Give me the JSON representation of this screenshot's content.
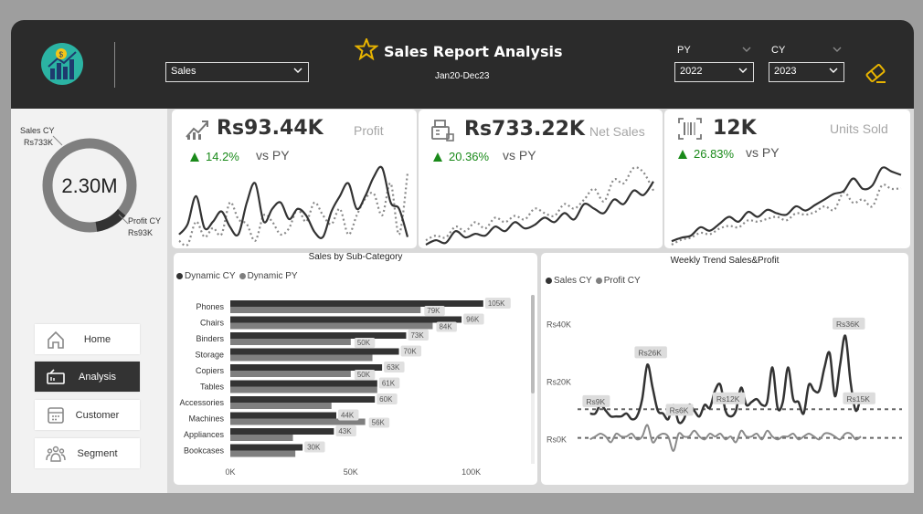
{
  "header": {
    "title": "Sales Report Analysis",
    "subtitle": "Jan20-Dec23",
    "measure_selector": {
      "value": "Sales"
    },
    "py_label": "PY",
    "py_value": "2022",
    "cy_label": "CY",
    "cy_value": "2023"
  },
  "sidebar": {
    "donut": {
      "center_text": "2.30M",
      "sales_label": "Sales CY",
      "sales_value": "Rs733K",
      "profit_label": "Profit CY",
      "profit_value": "Rs93K",
      "sales_share": 0.887,
      "profit_share": 0.113
    },
    "nav": [
      {
        "label": "Home",
        "icon": "home-icon"
      },
      {
        "label": "Analysis",
        "icon": "analysis-icon",
        "active": true
      },
      {
        "label": "Customer",
        "icon": "customer-icon"
      },
      {
        "label": "Segment",
        "icon": "segment-icon"
      }
    ]
  },
  "kpis": [
    {
      "value": "Rs93.44K",
      "label": "Profit",
      "delta": "14.2%",
      "vs": "vs PY",
      "icon": "trend-up-icon"
    },
    {
      "value": "Rs733.22K",
      "label": "Net Sales",
      "delta": "20.36%",
      "vs": "vs PY",
      "icon": "cash-register-icon"
    },
    {
      "value": "12K",
      "label": "Units Sold",
      "delta": "26.83%",
      "vs": "vs PY",
      "icon": "barcode-icon"
    }
  ],
  "colors": {
    "header": "#2b2b2b",
    "dark_series": "#333333",
    "light_series": "#7f7f7f",
    "positive": "#1a8a1a",
    "accent": "#e8b400",
    "logo_bg": "#2bb3a3"
  },
  "chart_data": [
    {
      "type": "bar",
      "title": "Sales by Sub-Category",
      "categories": [
        "Phones",
        "Chairs",
        "Binders",
        "Storage",
        "Copiers",
        "Tables",
        "Accessories",
        "Machines",
        "Appliances",
        "Bookcases"
      ],
      "series": [
        {
          "name": "Dynamic CY",
          "values": [
            105,
            96,
            73,
            70,
            63,
            61,
            60,
            44,
            43,
            30
          ]
        },
        {
          "name": "Dynamic PY",
          "values": [
            79,
            84,
            50,
            59,
            50,
            61,
            42,
            56,
            26,
            27
          ]
        }
      ],
      "data_labels": [
        "105K",
        "96K",
        "73K",
        "70K",
        "63K",
        "61K",
        "60K",
        "44K",
        "43K",
        "30K"
      ],
      "pyonly_labels": [
        "79K",
        "84K",
        "50K",
        null,
        "50K",
        null,
        null,
        "56K",
        null,
        null
      ],
      "xticks": [
        "0K",
        "50K",
        "100K"
      ],
      "xlim": [
        0,
        110
      ],
      "legend": "top-left"
    },
    {
      "type": "line",
      "title": "Weekly Trend Sales&Profit",
      "x": [
        1,
        2,
        3,
        4,
        5,
        6,
        7,
        8,
        9,
        10,
        11,
        12,
        13,
        14,
        15,
        16,
        17,
        18,
        19,
        20,
        21,
        22,
        23,
        24,
        25,
        26,
        27,
        28,
        29,
        30,
        31,
        32,
        33,
        34,
        35,
        36,
        37,
        38,
        39,
        40,
        41,
        42,
        43,
        44,
        45,
        46,
        47,
        48,
        49,
        50,
        51,
        52,
        53
      ],
      "series": [
        {
          "name": "Sales CY",
          "values": [
            9,
            9,
            12,
            10,
            8,
            8,
            8,
            9,
            7,
            8,
            14,
            26,
            18,
            10,
            9,
            7,
            12,
            6,
            7,
            12,
            10,
            8,
            12,
            11,
            17,
            19,
            10,
            8,
            10,
            18,
            12,
            13,
            14,
            12,
            13,
            25,
            11,
            13,
            25,
            14,
            13,
            9,
            19,
            17,
            17,
            25,
            30,
            15,
            26,
            36,
            20,
            10,
            15
          ]
        },
        {
          "name": "Profit CY",
          "values": [
            0,
            1,
            2,
            1,
            -1,
            2,
            1,
            1,
            2,
            0,
            1,
            5,
            -1,
            1,
            2,
            1,
            -4,
            2,
            1,
            1,
            3,
            1,
            0,
            2,
            1,
            2,
            0,
            1,
            -1,
            3,
            1,
            1,
            2,
            0,
            3,
            1,
            0,
            1,
            1,
            2,
            0,
            1,
            2,
            1,
            0,
            2,
            2,
            1,
            0,
            2,
            2,
            0,
            1
          ]
        }
      ],
      "reference_lines": [
        10.5,
        0.5
      ],
      "annotations": [
        "Rs9K",
        "Rs26K",
        "Rs6K",
        "Rs12K",
        "Rs36K",
        "Rs15K"
      ],
      "yticks": [
        "Rs0K",
        "Rs20K",
        "Rs40K"
      ],
      "xticks": [
        "0",
        "20",
        "40",
        "60"
      ],
      "xlim": [
        0,
        60
      ],
      "ylim": [
        -5,
        42
      ],
      "legend": "top-left"
    }
  ],
  "sparklines": {
    "profit": {
      "cy": [
        30,
        38,
        60,
        35,
        40,
        48,
        36,
        30,
        55,
        70,
        40,
        50,
        55,
        42,
        50,
        45,
        32,
        28,
        48,
        60,
        70,
        50,
        60,
        75,
        82,
        55,
        50,
        28
      ],
      "py": [
        25,
        22,
        40,
        28,
        35,
        30,
        55,
        42,
        38,
        25,
        45,
        40,
        30,
        35,
        50,
        40,
        55,
        45,
        38,
        50,
        30,
        45,
        58,
        62,
        45,
        70,
        30,
        78
      ]
    },
    "netsales": {
      "cy": [
        10,
        15,
        12,
        25,
        18,
        22,
        20,
        30,
        25,
        35,
        28,
        32,
        40,
        35,
        45,
        38,
        55,
        50,
        45,
        60,
        55,
        70,
        65,
        80
      ],
      "py": [
        15,
        20,
        18,
        30,
        25,
        35,
        28,
        40,
        35,
        42,
        38,
        50,
        45,
        42,
        55,
        50,
        60,
        72,
        58,
        82,
        78,
        95,
        90,
        70
      ]
    },
    "units": {
      "cy": [
        20,
        25,
        28,
        40,
        35,
        45,
        55,
        48,
        62,
        55,
        65,
        60,
        58,
        70,
        64,
        72,
        80,
        88,
        92,
        110,
        95,
        100,
        125,
        120,
        115
      ],
      "py": [
        15,
        22,
        25,
        32,
        30,
        38,
        42,
        40,
        50,
        48,
        52,
        55,
        50,
        60,
        58,
        62,
        70,
        65,
        90,
        75,
        80,
        70,
        100,
        95,
        96
      ]
    }
  }
}
